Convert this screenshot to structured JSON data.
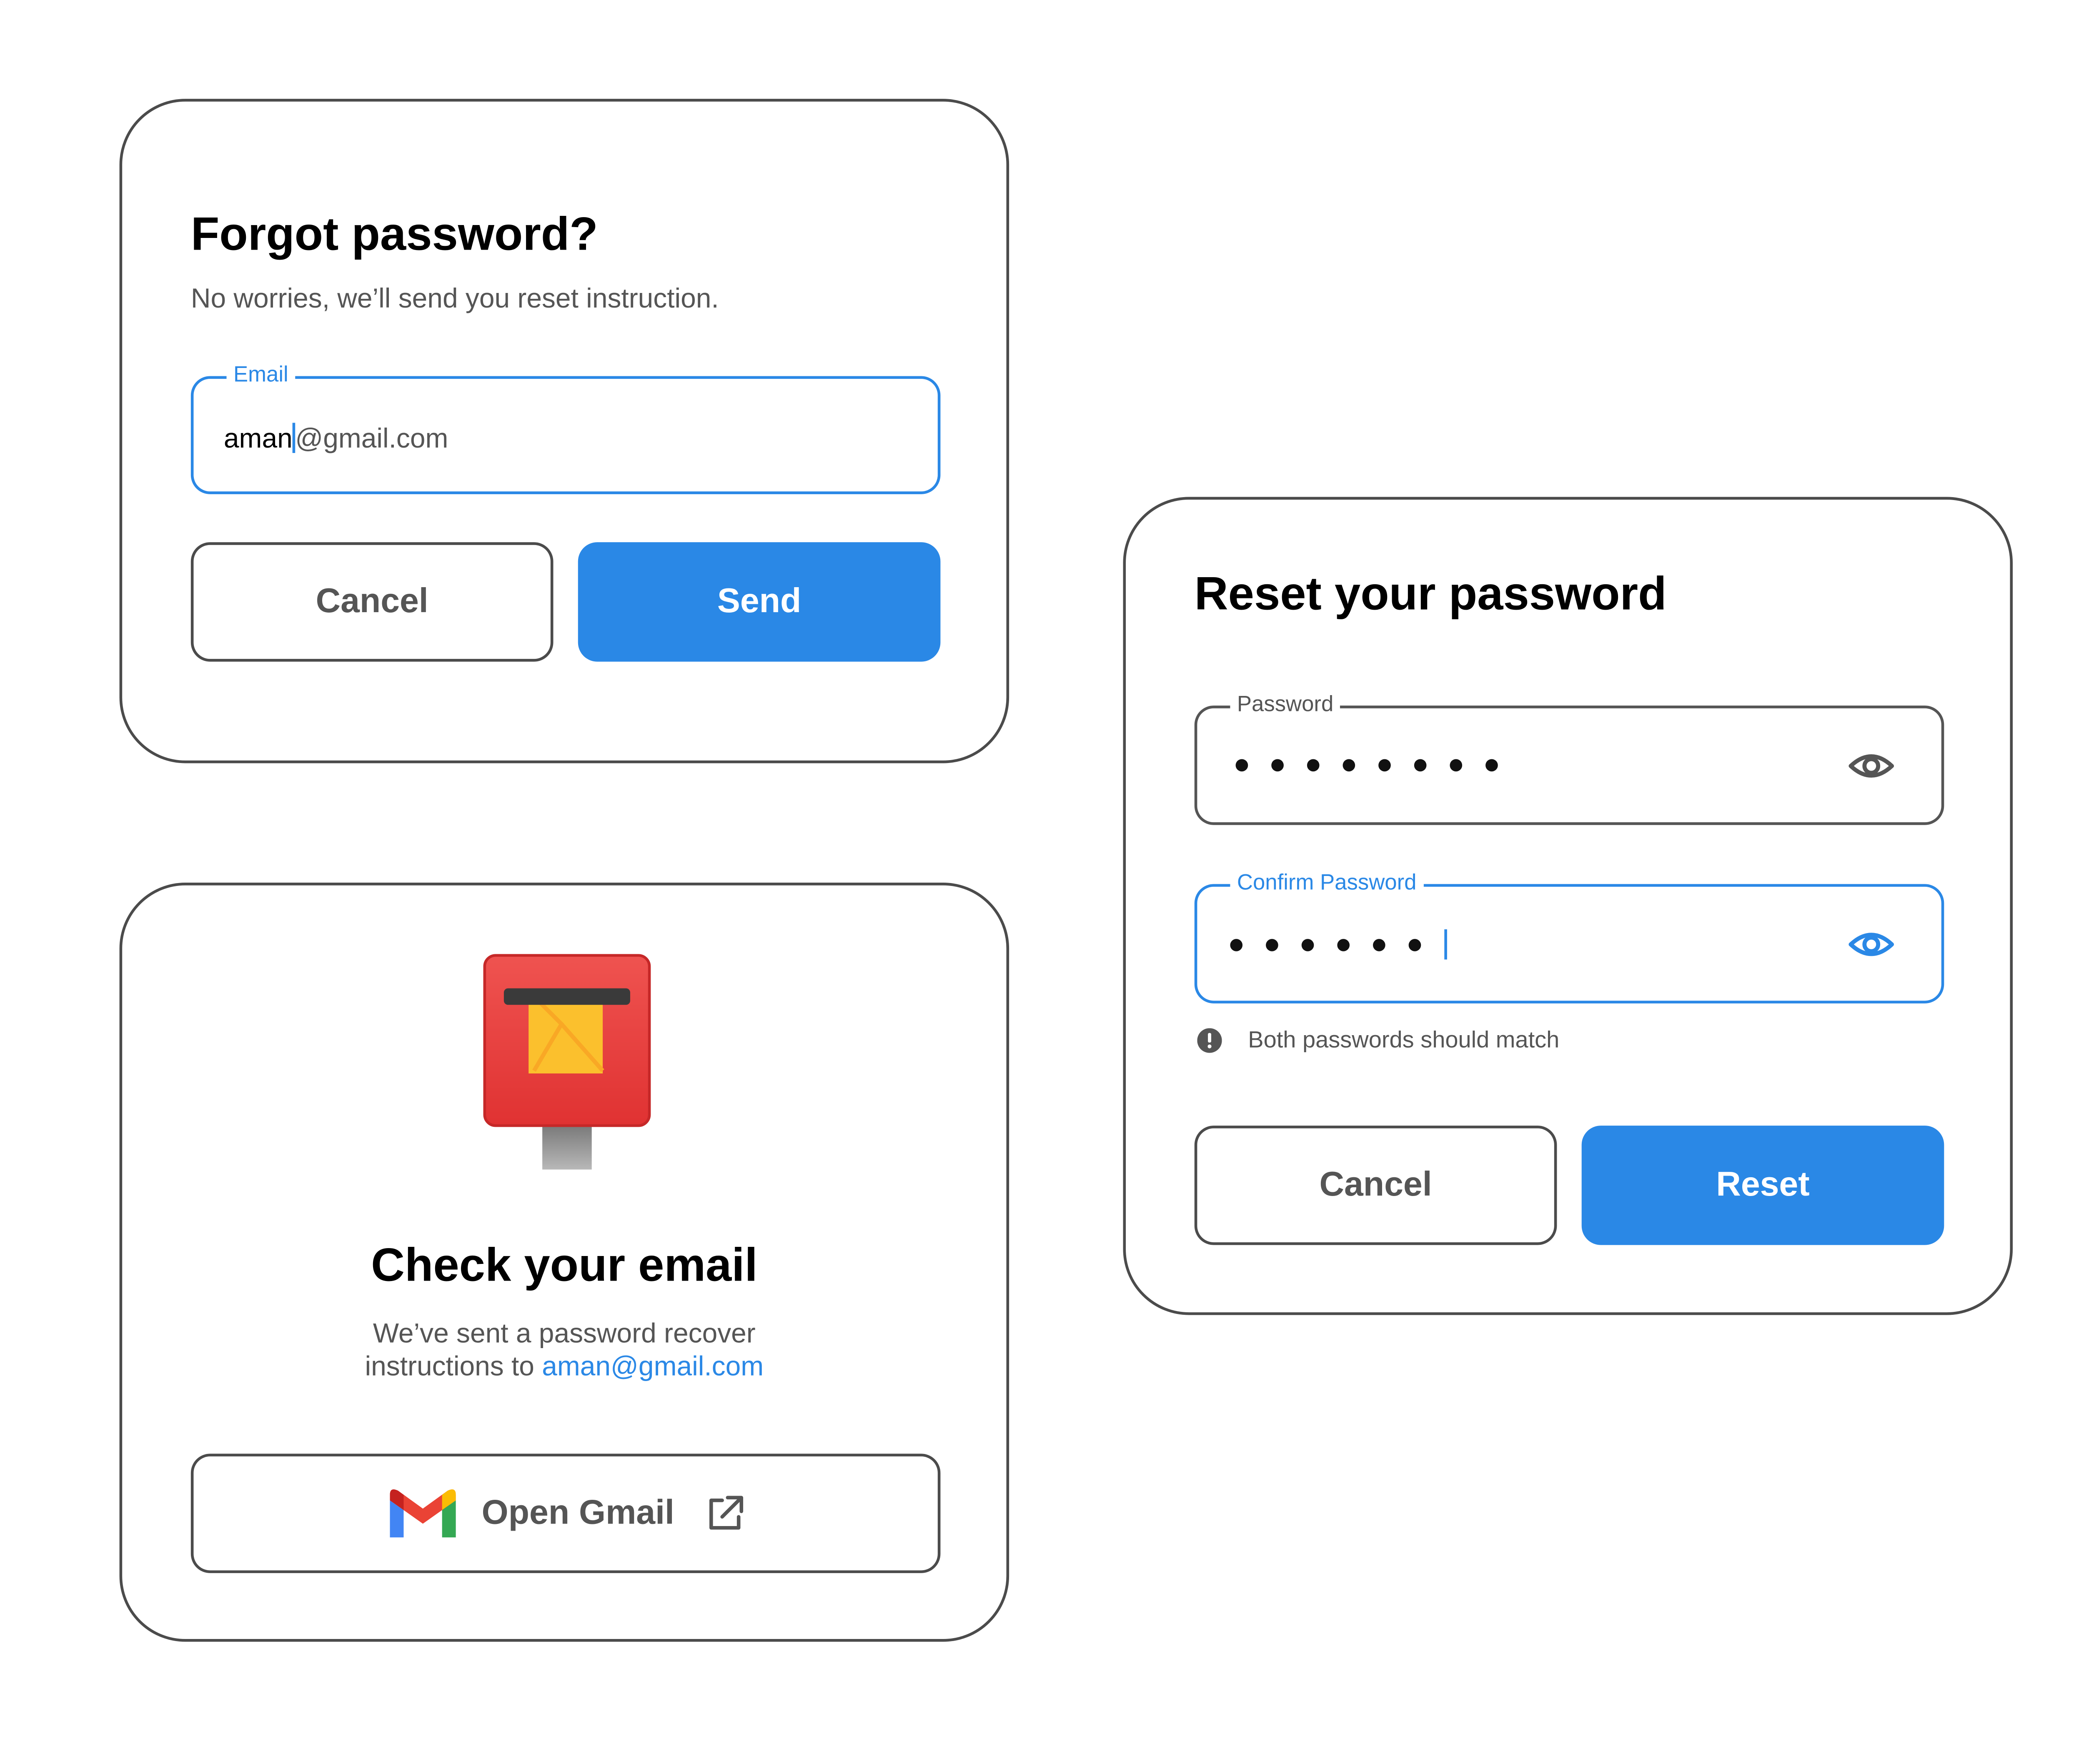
{
  "forgot": {
    "title": "Forgot password?",
    "subtitle": "No worries, we’ll send you reset instruction.",
    "email_label": "Email",
    "email_typed": "aman",
    "email_suggestion": "@gmail.com",
    "cancel_label": "Cancel",
    "send_label": "Send"
  },
  "check_email": {
    "title": "Check your email",
    "line1": "We’ve sent a password recover",
    "line2_prefix": "instructions to ",
    "email_link": "aman@gmail.com",
    "open_gmail_label": "Open Gmail"
  },
  "reset": {
    "title": "Reset your password",
    "password_label": "Password",
    "password_mask_count": 8,
    "confirm_label": "Confirm Password",
    "confirm_mask_count": 6,
    "warning_text": "Both passwords should match",
    "cancel_label": "Cancel",
    "reset_label": "Reset"
  },
  "colors": {
    "accent": "#2a88e6",
    "border": "#4b4b4b",
    "muted_text": "#555555"
  },
  "icons": {
    "postbox": "postbox-icon",
    "gmail": "gmail-logo-icon",
    "external": "external-link-icon",
    "eye": "eye-icon",
    "warning": "alert-circle-icon"
  }
}
